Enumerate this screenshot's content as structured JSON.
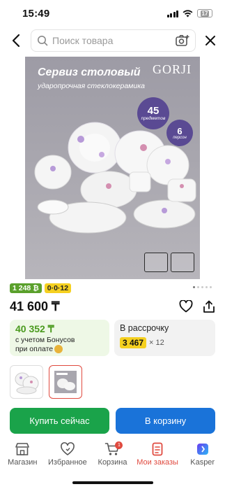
{
  "status_bar": {
    "time": "15:49",
    "battery": "17"
  },
  "search": {
    "placeholder": "Поиск товара"
  },
  "product_image": {
    "title": "Сервиз столовый",
    "subtitle": "ударопрочная стеклокерамика",
    "brand": "GORJI",
    "badge_count": "45",
    "badge_count_label": "предметов",
    "badge_persons": "6",
    "badge_persons_label": "персон"
  },
  "chips": {
    "green": "1 248 ₿",
    "yellow": "0·0·12"
  },
  "price": {
    "main": "41 600 ₸"
  },
  "bonus_card": {
    "price": "40 352 ₸",
    "note_line1": "с учетом Бонусов",
    "note_line2": "при оплате"
  },
  "installment_card": {
    "title": "В рассрочку",
    "amount": "3 467",
    "months": "× 12"
  },
  "actions": {
    "buy": "Купить сейчас",
    "cart": "В корзину"
  },
  "bottom_nav": [
    {
      "label": "Магазин",
      "icon": "store-icon"
    },
    {
      "label": "Избранное",
      "icon": "heart-icon"
    },
    {
      "label": "Корзина",
      "icon": "cart-icon",
      "badge": "1"
    },
    {
      "label": "Мои заказы",
      "icon": "orders-icon",
      "active": true
    },
    {
      "label": "Kasper",
      "icon": "kasper-icon"
    }
  ],
  "colors": {
    "accent_red": "#e04a3f",
    "buy_green": "#1aa34a",
    "cart_blue": "#1a73d9",
    "bonus_green": "#4a9a1e",
    "chip_yellow": "#f5d020"
  }
}
